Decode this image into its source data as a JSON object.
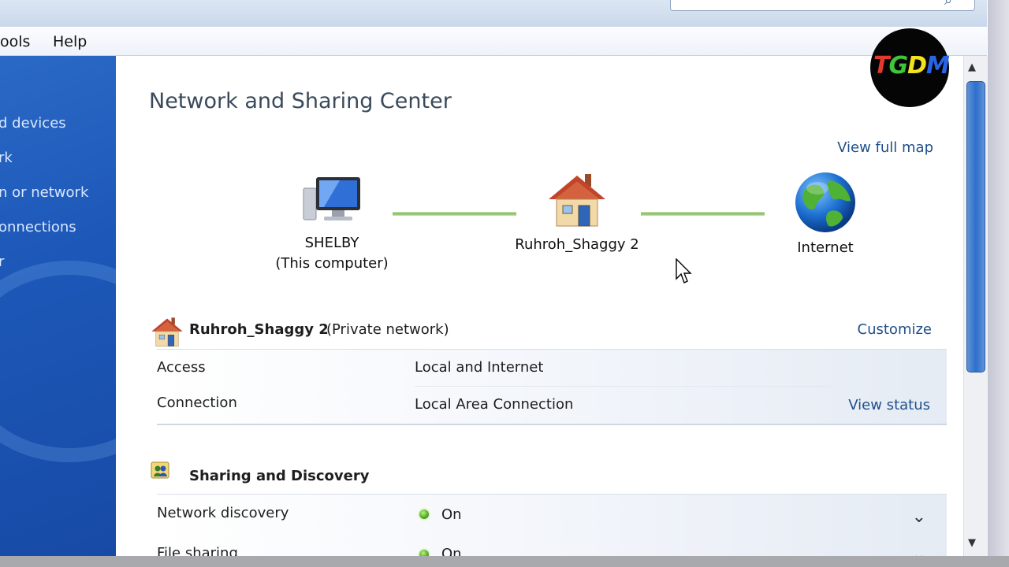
{
  "menu": {
    "tools": "ools",
    "help": "Help"
  },
  "left_nav": [
    {
      "label": "d devices"
    },
    {
      "label": "rk"
    },
    {
      "label": "n or network"
    },
    {
      "label": "onnections"
    },
    {
      "label": "r"
    }
  ],
  "header": {
    "title": "Network and Sharing Center",
    "view_full_map": "View full map"
  },
  "map": {
    "computer": {
      "name": "SHELBY",
      "sub": "(This computer)",
      "icon": "computer-icon"
    },
    "network": {
      "name": "Ruhroh_Shaggy  2",
      "icon": "house-icon"
    },
    "internet": {
      "name": "Internet",
      "icon": "globe-icon"
    },
    "link_color": "#7fb956"
  },
  "network": {
    "name": "Ruhroh_Shaggy  2",
    "type": "(Private network)",
    "customize": "Customize",
    "rows": [
      {
        "label": "Access",
        "value": "Local and Internet"
      },
      {
        "label": "Connection",
        "value": "Local Area Connection"
      }
    ],
    "view_status": "View status"
  },
  "sharing": {
    "title": "Sharing and Discovery",
    "rows": [
      {
        "label": "Network discovery",
        "value": "On"
      },
      {
        "label": "File sharing",
        "value": "On"
      }
    ]
  },
  "logo": {
    "text": "TGDM"
  },
  "colors": {
    "accent": "#1f4f8b",
    "nav_blue": "#1d58b8",
    "status_on": "#3d9d12"
  }
}
